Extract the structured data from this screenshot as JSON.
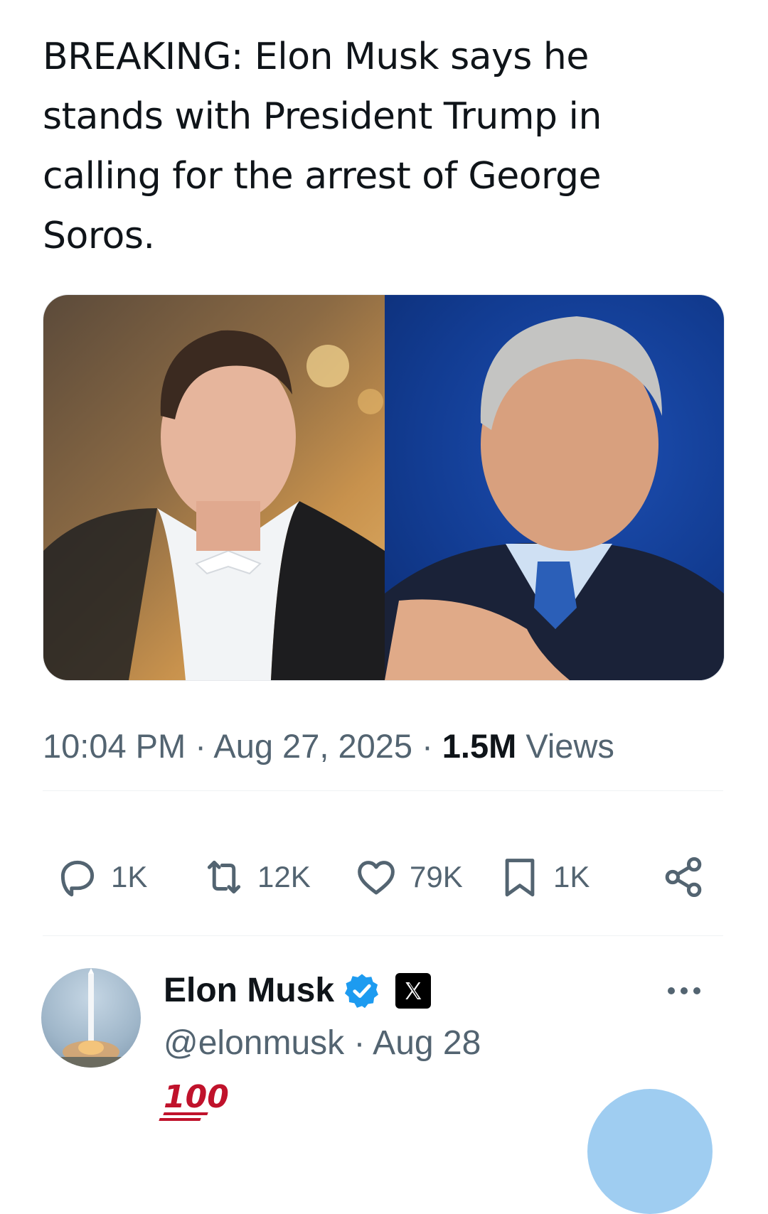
{
  "tweet": {
    "text": "BREAKING: Elon Musk says he stands with President Trump in calling for the arrest of George Soros.",
    "time": "10:04 PM",
    "date": "Aug 27, 2025",
    "views_count": "1.5M",
    "views_label": "Views"
  },
  "actions": {
    "replies": "1K",
    "reposts": "12K",
    "likes": "79K",
    "bookmarks": "1K"
  },
  "reply": {
    "name": "Elon Musk",
    "handle": "@elonmusk",
    "date": "Aug 28",
    "body": "100"
  },
  "colors": {
    "text": "#0f1419",
    "muted": "#536471",
    "verified": "#1d9bf0",
    "emoji_red": "#c0122b"
  },
  "icons": [
    "reply-icon",
    "repost-icon",
    "like-icon",
    "bookmark-icon",
    "share-icon",
    "verified-badge-icon",
    "x-logo-icon",
    "more-icon",
    "hundred-points-emoji"
  ]
}
